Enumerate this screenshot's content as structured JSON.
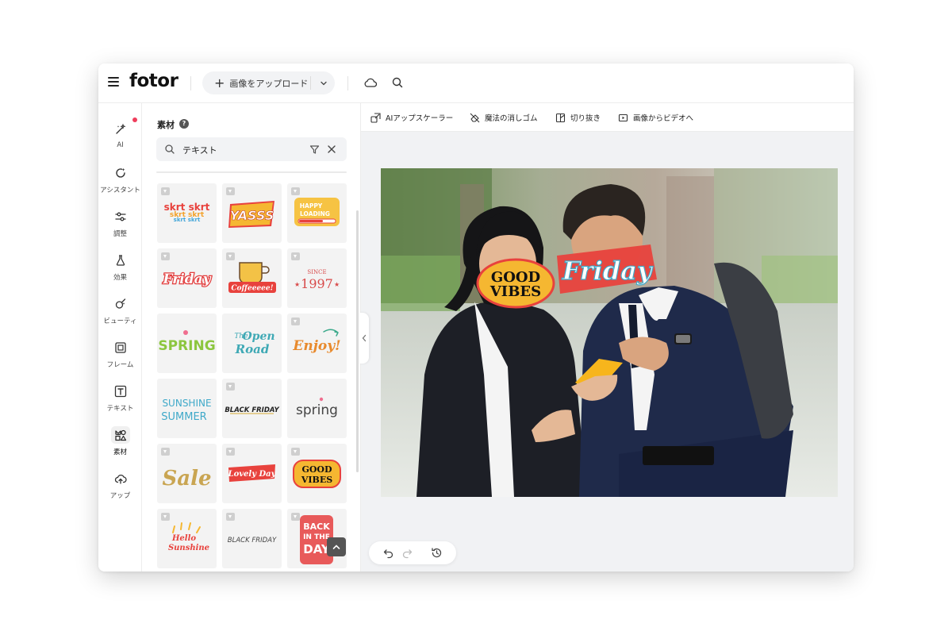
{
  "app": {
    "logo": "fotor",
    "upload_label": "画像をアップロード",
    "upload_plus": "+"
  },
  "rail": {
    "items": [
      {
        "label": "AI",
        "icon": "magic-wand-icon"
      },
      {
        "label": "アシスタント",
        "icon": "assistant-icon"
      },
      {
        "label": "調整",
        "icon": "sliders-icon"
      },
      {
        "label": "効果",
        "icon": "flask-icon"
      },
      {
        "label": "ビューティ",
        "icon": "beauty-icon"
      },
      {
        "label": "フレーム",
        "icon": "frame-icon"
      },
      {
        "label": "テキスト",
        "icon": "text-icon"
      },
      {
        "label": "素材",
        "icon": "elements-icon"
      },
      {
        "label": "アップ",
        "icon": "cloud-upload-icon"
      }
    ]
  },
  "panel": {
    "title": "素材",
    "help": "?",
    "search_value": "テキスト",
    "stickers": [
      {
        "text": "skrt skrt",
        "premium": true
      },
      {
        "text": "YASSS",
        "premium": true
      },
      {
        "text": "HAPPY LOADING",
        "premium": true
      },
      {
        "text": "Friday",
        "premium": true
      },
      {
        "text": "Coffeeeee!",
        "premium": true
      },
      {
        "text": "SINCE 1997",
        "premium": true
      },
      {
        "text": "SPRING",
        "premium": false
      },
      {
        "text": "The Open Road",
        "premium": false
      },
      {
        "text": "Enjoy!",
        "premium": true
      },
      {
        "text": "SUNSHINE SUMMER",
        "premium": false
      },
      {
        "text": "BLACK FRIDAY",
        "premium": true
      },
      {
        "text": "spring",
        "premium": false
      },
      {
        "text": "Sale",
        "premium": true
      },
      {
        "text": "Lovely Day",
        "premium": true
      },
      {
        "text": "GOOD VIBES",
        "premium": true
      },
      {
        "text": "Hello Sunshine",
        "premium": true
      },
      {
        "text": "BLACK FRIDAY",
        "premium": true
      },
      {
        "text": "BACK IN THE DAY",
        "premium": true
      }
    ]
  },
  "toolbar": {
    "tools": [
      {
        "label": "AIアップスケーラー",
        "icon": "upscale-icon"
      },
      {
        "label": "魔法の消しゴム",
        "icon": "eraser-icon"
      },
      {
        "label": "切り抜き",
        "icon": "cutout-icon"
      },
      {
        "label": "画像からビデオへ",
        "icon": "video-icon"
      }
    ]
  },
  "canvas": {
    "overlay_1": "GOOD VIBES",
    "overlay_2": "Friday"
  },
  "colors": {
    "accent_dot": "#ef3e5c",
    "panel_bg": "#ffffff",
    "workspace_bg": "#f1f2f4"
  }
}
